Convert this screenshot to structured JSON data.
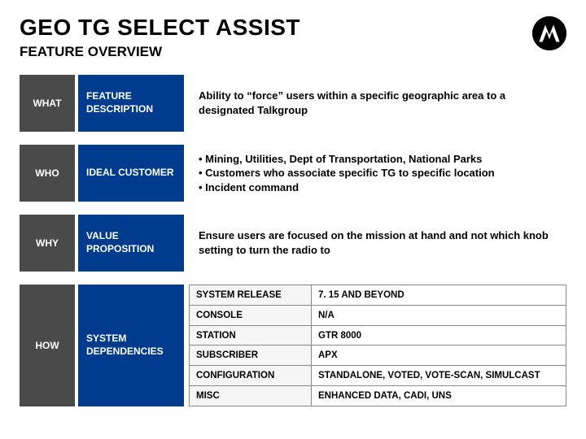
{
  "header": {
    "title": "GEO TG SELECT ASSIST",
    "subtitle": "FEATURE OVERVIEW"
  },
  "rows": {
    "what": {
      "tag": "WHAT",
      "label": "FEATURE DESCRIPTION",
      "text": "Ability to “force” users within a specific geographic area to a designated Talkgroup"
    },
    "who": {
      "tag": "WHO",
      "label": "IDEAL CUSTOMER",
      "bullets": [
        "Mining, Utilities, Dept of Transportation, National Parks",
        "Customers who associate specific TG to specific location",
        "Incident command"
      ]
    },
    "why": {
      "tag": "WHY",
      "label": "VALUE PROPOSITION",
      "text": "Ensure users are focused on the mission at hand and not which knob setting to turn the radio to"
    },
    "how": {
      "tag": "HOW",
      "label": "SYSTEM DEPENDENCIES",
      "deps": [
        {
          "k": "SYSTEM RELEASE",
          "v": "7. 15 AND BEYOND"
        },
        {
          "k": "CONSOLE",
          "v": "N/A"
        },
        {
          "k": "STATION",
          "v": "GTR 8000"
        },
        {
          "k": "SUBSCRIBER",
          "v": "APX"
        },
        {
          "k": "CONFIGURATION",
          "v": "STANDALONE, VOTED, VOTE-SCAN, SIMULCAST"
        },
        {
          "k": "MISC",
          "v": "ENHANCED DATA, CADI, UNS"
        }
      ]
    }
  }
}
